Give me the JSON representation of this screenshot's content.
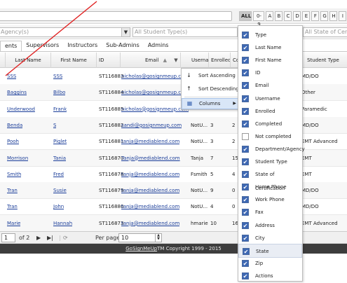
{
  "alpha_filters": [
    "ALL",
    "0-9",
    "A",
    "B",
    "C",
    "D",
    "E",
    "F",
    "G",
    "H",
    "I",
    "J"
  ],
  "filters": {
    "agency_placeholder": "Agency(s)",
    "student_type_placeholder": "All Student Type(s)",
    "state_placeholder": "All State of Cert"
  },
  "tabs": [
    "ents",
    "Supervisors",
    "Instructors",
    "Sub-Admins",
    "Admins"
  ],
  "grid": {
    "headers": {
      "last_name": "Last Name",
      "first_name": "First Name",
      "id": "ID",
      "email": "Email",
      "username": "Userna",
      "enrolled": "Enrolled",
      "co": "Co",
      "student_type": "Student Type"
    },
    "rows": [
      {
        "last": "SSS",
        "first": "SSS",
        "id": "ST116883",
        "email": "nicholas@gosignmeup.com",
        "username": "",
        "enrolled": "",
        "co": "",
        "student_type": "MD/DO"
      },
      {
        "last": "Baggins",
        "first": "Bilbo",
        "id": "ST116884",
        "email": "nicholas@gosignmeup.com",
        "username": "",
        "enrolled": "",
        "co": "",
        "student_type": "Other"
      },
      {
        "last": "Underwood",
        "first": "Frank",
        "id": "ST116885",
        "email": "nicholas@gosignmeup.com",
        "username": "",
        "enrolled": "",
        "co": "",
        "student_type": "Paramedic"
      },
      {
        "last": "Benda",
        "first": "S",
        "id": "ST116882",
        "email": "sandi@gosignmeup.com",
        "username": "NotU...",
        "enrolled": "3",
        "co": "2",
        "student_type": "MD/DO"
      },
      {
        "last": "Pooh",
        "first": "Piglet",
        "id": "ST116881",
        "email": "tanja@mediablend.com",
        "username": "NotU...",
        "enrolled": "3",
        "co": "2",
        "student_type": "EMT Advanced"
      },
      {
        "last": "Morrison",
        "first": "Tania",
        "id": "ST116870",
        "email": "Tanja@mediablend.com",
        "username": "Tanja",
        "enrolled": "7",
        "co": "15",
        "student_type": "EMT"
      },
      {
        "last": "Smith",
        "first": "Fred",
        "id": "ST116878",
        "email": "tanja@mediablend.com",
        "username": "Fsmith",
        "enrolled": "5",
        "co": "4",
        "student_type": "EMT"
      },
      {
        "last": "Tran",
        "first": "Susie",
        "id": "ST116879",
        "email": "tanja@mediablend.com",
        "username": "NotU...",
        "enrolled": "9",
        "co": "0",
        "student_type": "MD/DO"
      },
      {
        "last": "Tran",
        "first": "John",
        "id": "ST116880",
        "email": "tanja@mediablend.com",
        "username": "NotU...",
        "enrolled": "4",
        "co": "0",
        "student_type": "MD/DO"
      },
      {
        "last": "Marie",
        "first": "Hannah",
        "id": "ST116873",
        "email": "tanja@mediablend.com",
        "username": "hmarie",
        "enrolled": "10",
        "co": "16",
        "student_type": "EMT Advanced"
      }
    ]
  },
  "pager": {
    "page": "1",
    "of": "of 2",
    "per_page_label": "Per page:",
    "per_page": "10"
  },
  "footer": {
    "brand": "GoSignMeUp",
    "tm": "TM",
    "copyright": " Copyright 1999 - 2015"
  },
  "column_menu": {
    "sort_asc": "Sort Ascending",
    "sort_desc": "Sort Descending",
    "columns": "Columns"
  },
  "column_list": [
    {
      "label": "Type",
      "checked": true
    },
    {
      "label": "Last Name",
      "checked": true
    },
    {
      "label": "First Name",
      "checked": true
    },
    {
      "label": "ID",
      "checked": true
    },
    {
      "label": "Email",
      "checked": true
    },
    {
      "label": "Username",
      "checked": true
    },
    {
      "label": "Enrolled",
      "checked": true
    },
    {
      "label": "Completed",
      "checked": true
    },
    {
      "label": "Not completed",
      "checked": false
    },
    {
      "label": "Department/Agency",
      "checked": true
    },
    {
      "label": "Student Type",
      "checked": true
    },
    {
      "label": "State of Certification",
      "checked": true
    },
    {
      "label": "Home Phone",
      "checked": true
    },
    {
      "label": "Work Phone",
      "checked": true
    },
    {
      "label": "Fax",
      "checked": true
    },
    {
      "label": "Address",
      "checked": true
    },
    {
      "label": "City",
      "checked": true
    },
    {
      "label": "State",
      "checked": true
    },
    {
      "label": "Zip",
      "checked": true
    },
    {
      "label": "Actions",
      "checked": true
    }
  ],
  "colors": {
    "link": "#1a3d99",
    "checkbox": "#3e68b3",
    "footer_bg": "#3d3d3d",
    "annotation_line": "#e02020"
  }
}
